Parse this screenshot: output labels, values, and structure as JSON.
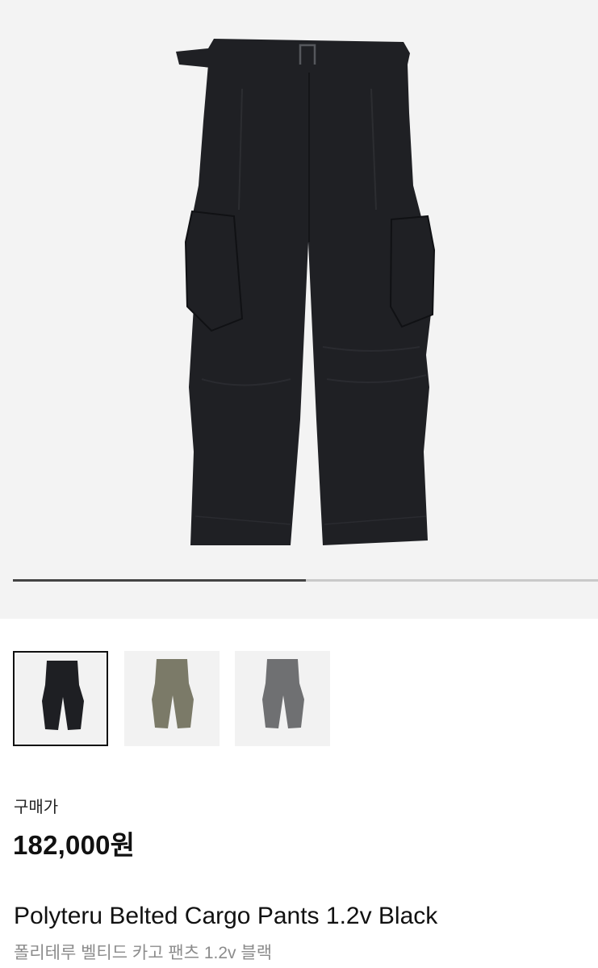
{
  "product": {
    "image_index": 1,
    "image_count": 2,
    "thumbnails": [
      {
        "name": "thumbnail-black",
        "color": "#1e1f23",
        "selected": true
      },
      {
        "name": "thumbnail-khaki",
        "color": "#7b7a68",
        "selected": false
      },
      {
        "name": "thumbnail-grey",
        "color": "#6f7072",
        "selected": false
      }
    ],
    "main_image_color": "#1f2024",
    "price_label": "구매가",
    "price": "182,000원",
    "name_en": "Polyteru Belted Cargo Pants 1.2v Black",
    "name_ko": "폴리테루 벨티드 카고 팬츠 1.2v 블랙"
  },
  "carousel": {
    "progress": 0.5
  }
}
